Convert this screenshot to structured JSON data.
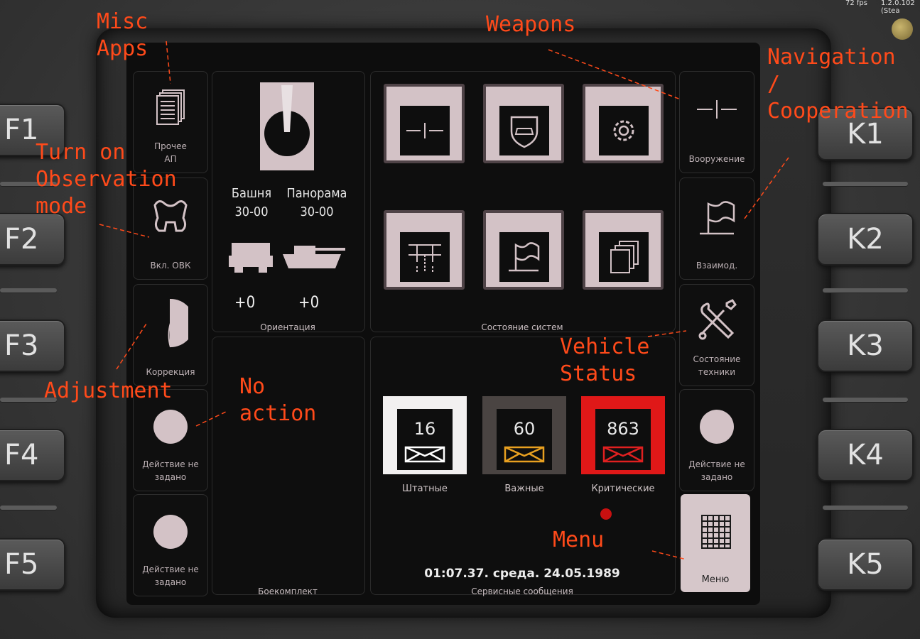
{
  "hud": {
    "fps": "72 fps",
    "version": "1.2.0.102 (Stea"
  },
  "f_keys": [
    "F1",
    "F2",
    "F3",
    "F4",
    "F5"
  ],
  "k_keys": [
    "K1",
    "K2",
    "K3",
    "K4",
    "K5"
  ],
  "left_column": [
    {
      "label": "Прочее\nАП",
      "icon": "documents-icon"
    },
    {
      "label": "Вкл. ОВК",
      "icon": "observation-icon"
    },
    {
      "label": "Коррекция",
      "icon": "correction-icon"
    },
    {
      "label": "Действие не\nзадано",
      "icon": "dot-icon"
    },
    {
      "label": "Действие не\nзадано",
      "icon": "dot-icon"
    }
  ],
  "right_column": [
    {
      "label": "Вооружение",
      "icon": "crosshair-icon"
    },
    {
      "label": "Взаимод.",
      "icon": "flag-icon"
    },
    {
      "label": "Состояние\nтехники",
      "icon": "tools-icon"
    },
    {
      "label": "Действие не\nзадано",
      "icon": "dot-icon"
    },
    {
      "label": "Меню",
      "icon": "grid-icon"
    }
  ],
  "orientation": {
    "title": "Ориентация",
    "turret_label": "Башня",
    "turret_value": "30-00",
    "panorama_label": "Панорама",
    "panorama_value": "30-00",
    "offset_left": "+0",
    "offset_right": "+0"
  },
  "systems": {
    "title": "Состояние систем",
    "tiles": [
      "crosshair-icon",
      "shield-tank-icon",
      "gear-icon",
      "mast-icon",
      "flag-icon",
      "documents-icon"
    ]
  },
  "ammo": {
    "title": "Боекомплект"
  },
  "messages": {
    "title": "Сервисные сообщения",
    "items": [
      {
        "count": "16",
        "label": "Штатные",
        "color": "#f2f0f0",
        "envelope": "#ffffff"
      },
      {
        "count": "60",
        "label": "Важные",
        "color": "#4a4442",
        "envelope": "#e8a020"
      },
      {
        "count": "863",
        "label": "Критические",
        "color": "#e01818",
        "envelope": "#e02020"
      }
    ],
    "datetime": "01:07.37. среда. 24.05.1989"
  },
  "annotations": {
    "misc": "Misc\nApps",
    "weapons": "Weapons",
    "navigation": "Navigation\n/\nCooperation",
    "observation": "Turn on\nObservation\nmode",
    "adjustment": "Adjustment",
    "no_action": "No\naction",
    "vehicle_status": "Vehicle\nStatus",
    "menu": "Menu"
  },
  "colors": {
    "accent": "#ff4a1a",
    "tile": "#d3c2c6",
    "alert": "#e01818"
  }
}
